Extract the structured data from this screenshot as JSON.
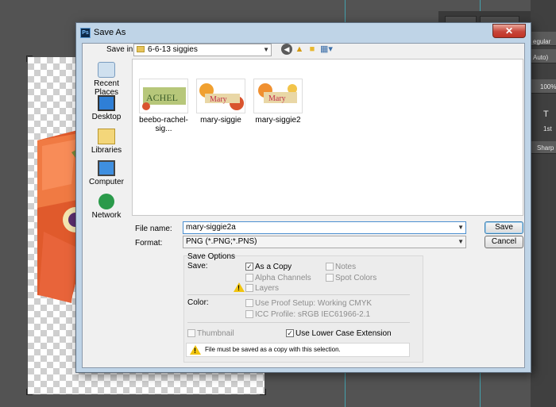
{
  "dialog": {
    "title": "Save As",
    "close_glyph": "✕",
    "save_in_label": "Save in:",
    "save_in_value": "6-6-13 siggies",
    "places": [
      {
        "label": "Recent Places",
        "icon": "recent-places-icon"
      },
      {
        "label": "Desktop",
        "icon": "desktop-icon"
      },
      {
        "label": "Libraries",
        "icon": "libraries-icon"
      },
      {
        "label": "Computer",
        "icon": "computer-icon"
      },
      {
        "label": "Network",
        "icon": "network-icon"
      }
    ],
    "files": [
      {
        "name": "beebo-rachel-sig..."
      },
      {
        "name": "mary-siggie"
      },
      {
        "name": "mary-siggie2"
      }
    ],
    "file_name_label": "File name:",
    "file_name_value": "mary-siggie2a",
    "format_label": "Format:",
    "format_value": "PNG (*.PNG;*.PNS)",
    "save_button": "Save",
    "cancel_button": "Cancel"
  },
  "save_options": {
    "header": "Save Options",
    "save_label": "Save:",
    "as_copy": {
      "label": "As a Copy",
      "checked": true
    },
    "alpha_channels": {
      "label": "Alpha Channels",
      "checked": false
    },
    "layers": {
      "label": "Layers",
      "checked": false
    },
    "notes": {
      "label": "Notes",
      "checked": false
    },
    "spot_colors": {
      "label": "Spot Colors",
      "checked": false
    },
    "color_label": "Color:",
    "use_proof_setup": {
      "label": "Use Proof Setup:  Working CMYK",
      "checked": false
    },
    "icc_profile": {
      "label": "ICC Profile:  sRGB IEC61966-2.1",
      "checked": false
    },
    "thumbnail": {
      "label": "Thumbnail",
      "checked": false
    },
    "lower_case": {
      "label": "Use Lower Case Extension",
      "checked": true
    },
    "warning_text": "File must be saved as a copy with this selection."
  },
  "ps_panel": {
    "texts": [
      "egular",
      "Auto)",
      "100%",
      "T",
      "1st",
      "Sharp"
    ]
  },
  "colors": {
    "titlebar": "#bfd4e7",
    "close_button": "#c7453a",
    "guide": "#3fb9c9",
    "default_button_border": "#3c7fb1"
  }
}
